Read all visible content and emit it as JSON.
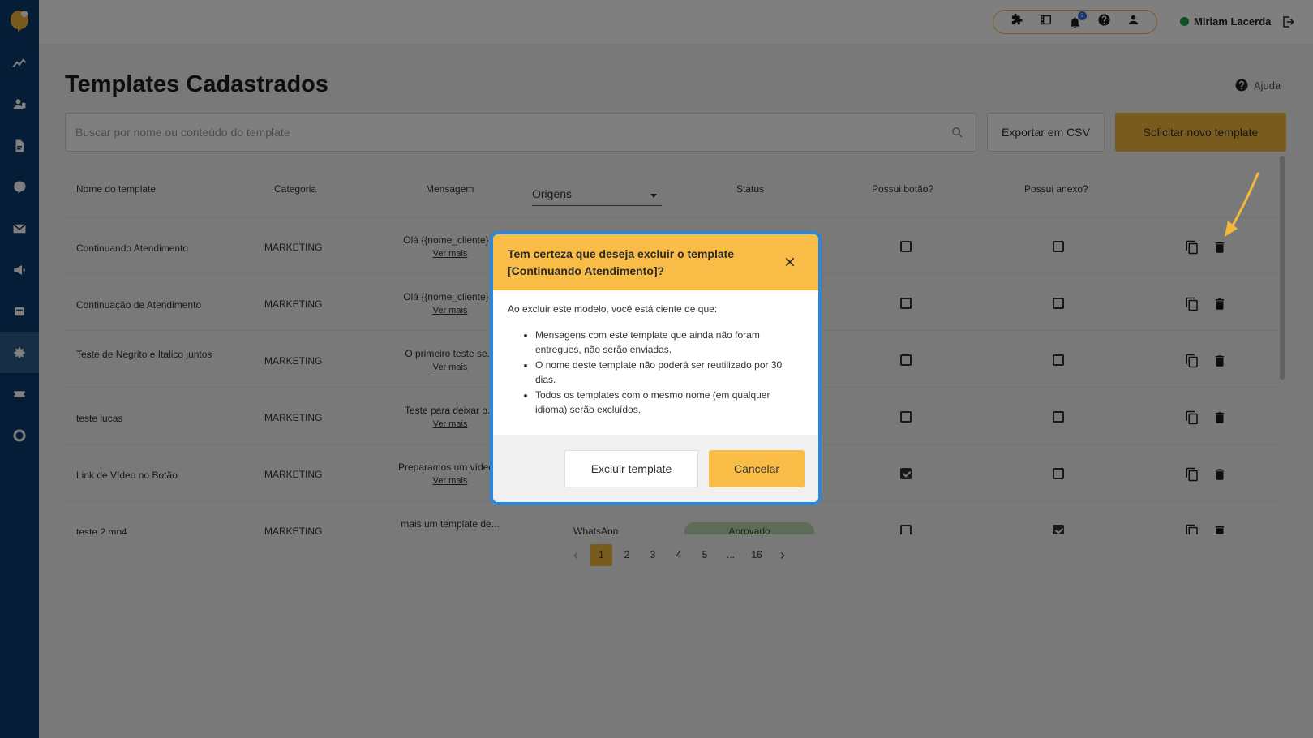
{
  "app": {
    "title": "Templates Cadastrados",
    "help_label": "Ajuda",
    "user_name": "Miriam Lacerda",
    "notification_count": "2",
    "accent_color": "#f4b73c",
    "sidebar_color": "#0d3b6e"
  },
  "sidebar": {
    "items": [
      {
        "icon": "analytics-icon"
      },
      {
        "icon": "contacts-icon"
      },
      {
        "icon": "document-icon"
      },
      {
        "icon": "chat-icon"
      },
      {
        "icon": "mail-icon"
      },
      {
        "icon": "megaphone-icon"
      },
      {
        "icon": "robot-icon"
      },
      {
        "icon": "gear-icon",
        "active": true
      },
      {
        "icon": "ticket-icon"
      },
      {
        "icon": "nps-icon"
      }
    ]
  },
  "toolbar": {
    "search_placeholder": "Buscar por nome ou conteúdo do template",
    "export_label": "Exportar em CSV",
    "new_label": "Solicitar novo template"
  },
  "table": {
    "headers": {
      "name": "Nome do template",
      "category": "Categoria",
      "message": "Mensagem",
      "origins": "Origens",
      "status": "Status",
      "has_button": "Possui botão?",
      "has_attachment": "Possui anexo?"
    },
    "see_more": "Ver mais",
    "rows": [
      {
        "name": "Continuando Atendimento",
        "category": "MARKETING",
        "message": "Olá {{nome_cliente}...",
        "origin": "",
        "status": "",
        "has_button": false,
        "has_attachment": false
      },
      {
        "name": "Continuação de Atendimento",
        "category": "MARKETING",
        "message": "Olá {{nome_cliente}...",
        "origin": "",
        "status": "",
        "has_button": false,
        "has_attachment": false
      },
      {
        "name": "Teste de Negrito e Italico juntos",
        "category": "MARKETING",
        "message": "O primeiro teste se...",
        "origin": "",
        "status": "",
        "has_button": false,
        "has_attachment": false
      },
      {
        "name": "teste lucas",
        "category": "MARKETING",
        "message": "Teste para deixar o...",
        "origin": "",
        "status": "",
        "has_button": false,
        "has_attachment": false
      },
      {
        "name": "Link de Vídeo no Botão",
        "category": "MARKETING",
        "message": "Preparamos um vídeo...",
        "origin": "",
        "status": "",
        "has_button": true,
        "has_attachment": false
      },
      {
        "name": "teste 2 mp4",
        "category": "MARKETING",
        "message": "mais um template de...",
        "origin": "WhatsApp",
        "status": "Aprovado",
        "has_button": false,
        "has_attachment": true
      }
    ]
  },
  "pagination": {
    "pages": [
      "1",
      "2",
      "3",
      "4",
      "5",
      "...",
      "16"
    ],
    "current": "1"
  },
  "modal": {
    "title": "Tem certeza que deseja excluir o template [Continuando Atendimento]?",
    "intro": "Ao excluir este modelo, você está ciente de que:",
    "bullets": [
      "Mensagens com este template que ainda não foram entregues, não serão enviadas.",
      "O nome deste template não poderá ser reutilizado por 30 dias.",
      "Todos os templates com o mesmo nome (em qualquer idioma) serão excluídos."
    ],
    "delete_label": "Excluir template",
    "cancel_label": "Cancelar",
    "header_color": "#f9bd47",
    "border_color": "#2c86d9"
  }
}
